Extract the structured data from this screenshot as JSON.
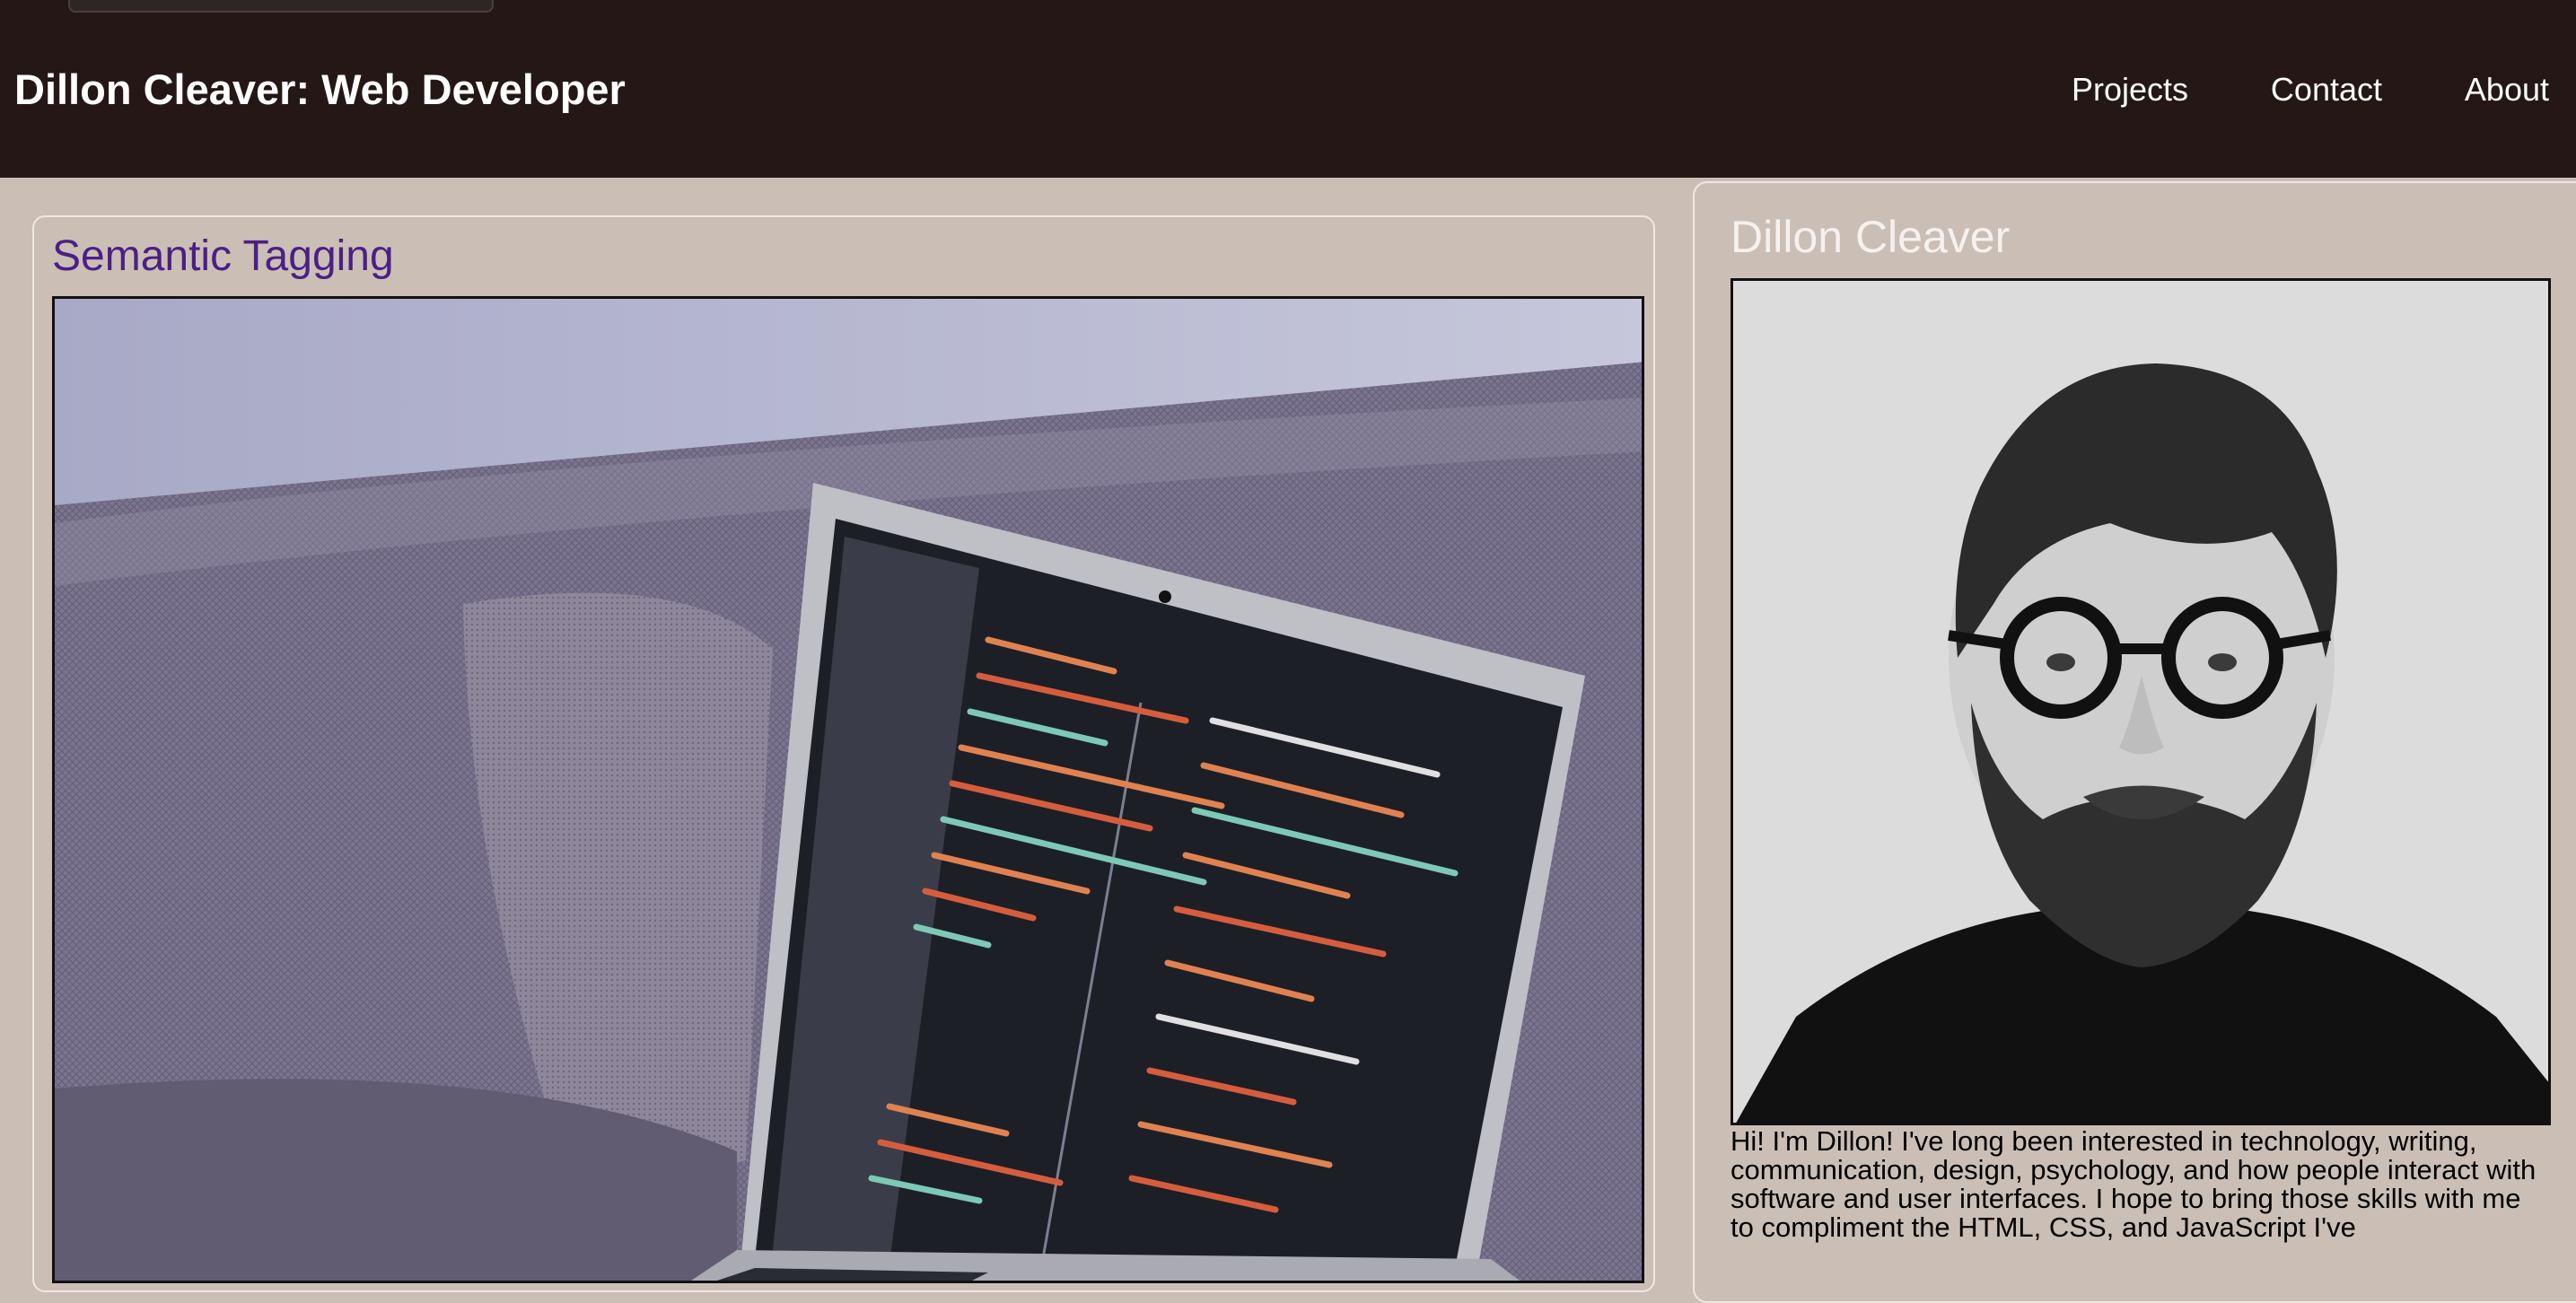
{
  "header": {
    "title": "Dillon Cleaver: Web Developer",
    "nav": [
      "Projects",
      "Contact",
      "About"
    ]
  },
  "article": {
    "title": "Semantic Tagging",
    "image_icon": "laptop-code-photo"
  },
  "aside": {
    "title": "Dillon Cleaver",
    "image_icon": "portrait-photo",
    "bio": "Hi! I'm Dillon! I've long been interested in technology, writing, communication, design, psychology, and how people interact with software and user interfaces. I hope to bring those skills with me to compliment the HTML, CSS, and JavaScript I've"
  },
  "colors": {
    "header_bg": "#241716",
    "page_bg": "#cbbfb5",
    "article_title": "#4b1f86",
    "aside_title": "#f6f1ee"
  }
}
